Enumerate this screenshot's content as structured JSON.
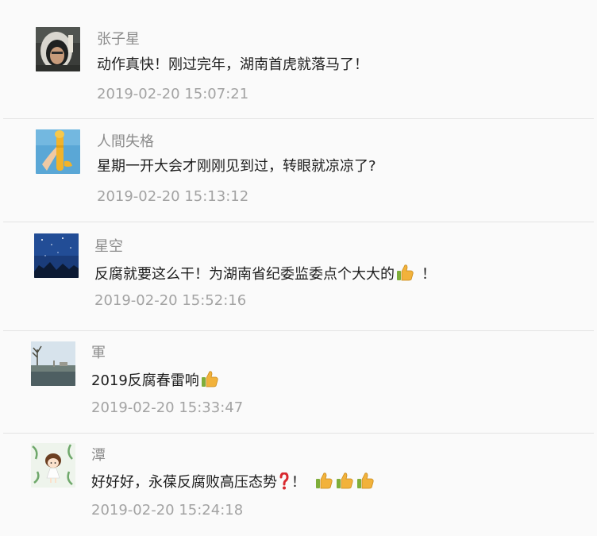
{
  "comments": [
    {
      "name": "张子星",
      "text": "动作真快！刚过完年，湖南首虎就落马了！",
      "time": "2019-02-20 15:07:21",
      "avatar_icon": "astronaut-avatar"
    },
    {
      "name": "人間失格",
      "text": "星期一开大会才刚刚见到过，转眼就凉凉了?",
      "time": "2019-02-20 15:13:12",
      "avatar_icon": "hand-holding-object-avatar"
    },
    {
      "name": "星空",
      "text_before": "反腐就要这么干！为湖南省纪委监委点个大大的",
      "text_after": "！",
      "time": "2019-02-20 15:52:16",
      "avatar_icon": "night-sky-avatar",
      "emoji": "thumbs-up-icon"
    },
    {
      "name": "軍",
      "text_before": "2019反腐春雷响",
      "time": "2019-02-20 15:33:47",
      "avatar_icon": "landscape-avatar",
      "emoji": "thumbs-up-icon"
    },
    {
      "name": "潭",
      "text_before": "好好好，永葆反腐败高压态势",
      "text_after": "！",
      "time": "2019-02-20 15:24:18",
      "avatar_icon": "cartoon-girl-avatar",
      "emoji": "thumbs-up-icon",
      "emoji_count": 3,
      "extra_icon": "red-question-mark-icon"
    }
  ],
  "colors": {
    "background": "#fafafa",
    "name": "#8c8c8c",
    "text": "#1d1d1d",
    "time": "#a3a3a3",
    "divider": "#e3e3e3"
  }
}
